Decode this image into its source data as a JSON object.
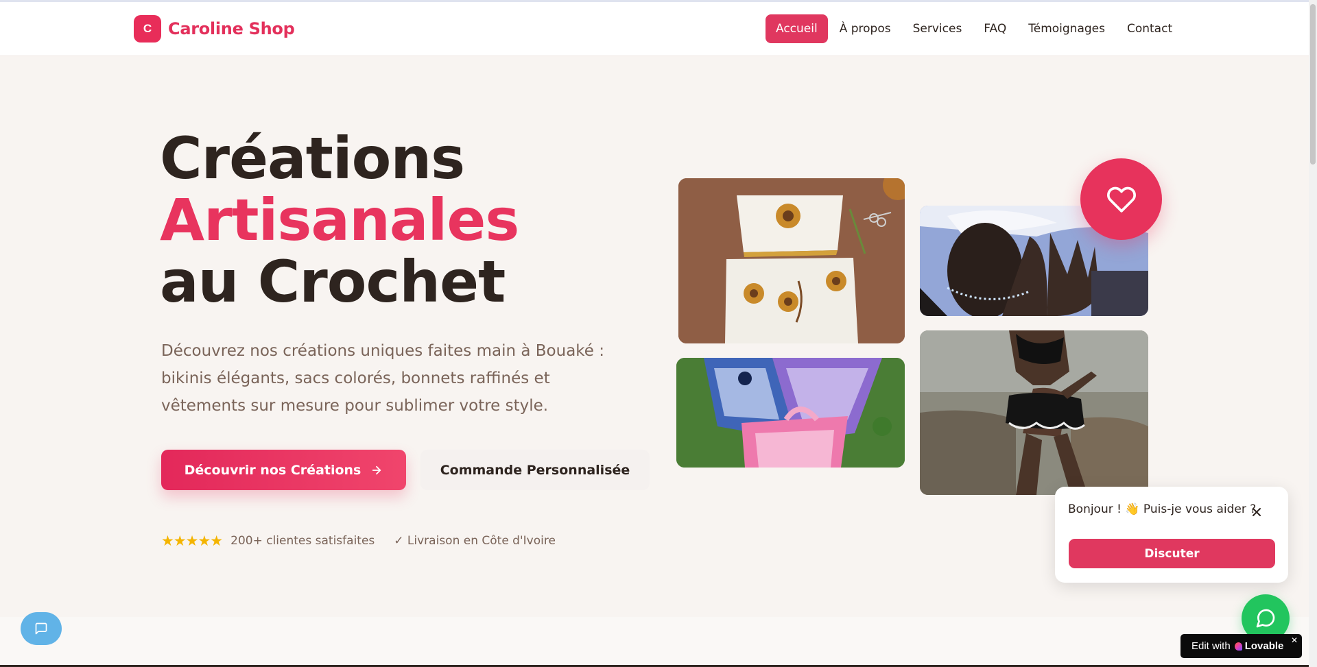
{
  "brand": {
    "badge": "C",
    "name": "Caroline Shop",
    "accent_color": "#e8345e"
  },
  "nav": {
    "items": [
      {
        "label": "Accueil",
        "active": true
      },
      {
        "label": "À propos"
      },
      {
        "label": "Services"
      },
      {
        "label": "FAQ"
      },
      {
        "label": "Témoignages"
      },
      {
        "label": "Contact"
      }
    ]
  },
  "hero": {
    "title_line1": "Créations",
    "title_line2": "Artisanales",
    "title_line3": "au Crochet",
    "description": "Découvrez nos créations uniques faites main à Bouaké : bikinis élégants, sacs colorés, bonnets raffinés et vêtements sur mesure pour sublimer votre style.",
    "primary_button": "Découvrir nos Créations",
    "secondary_button": "Commande Personnalisée",
    "stars": "★★★★★",
    "rating_text": "200+ clientes satisfaites",
    "delivery_text": "✓ Livraison en Côte d'Ivoire"
  },
  "chat": {
    "message": "Bonjour ! 👋 Puis-je vous aider ?",
    "button": "Discuter"
  },
  "lovable": {
    "prefix": "Edit with",
    "brand": "Lovable",
    "close": "✕"
  },
  "icons": {
    "heart": "heart-icon",
    "arrow": "arrow-right-icon",
    "close": "close-icon",
    "whatsapp": "whatsapp-icon",
    "chat": "chat-icon"
  }
}
